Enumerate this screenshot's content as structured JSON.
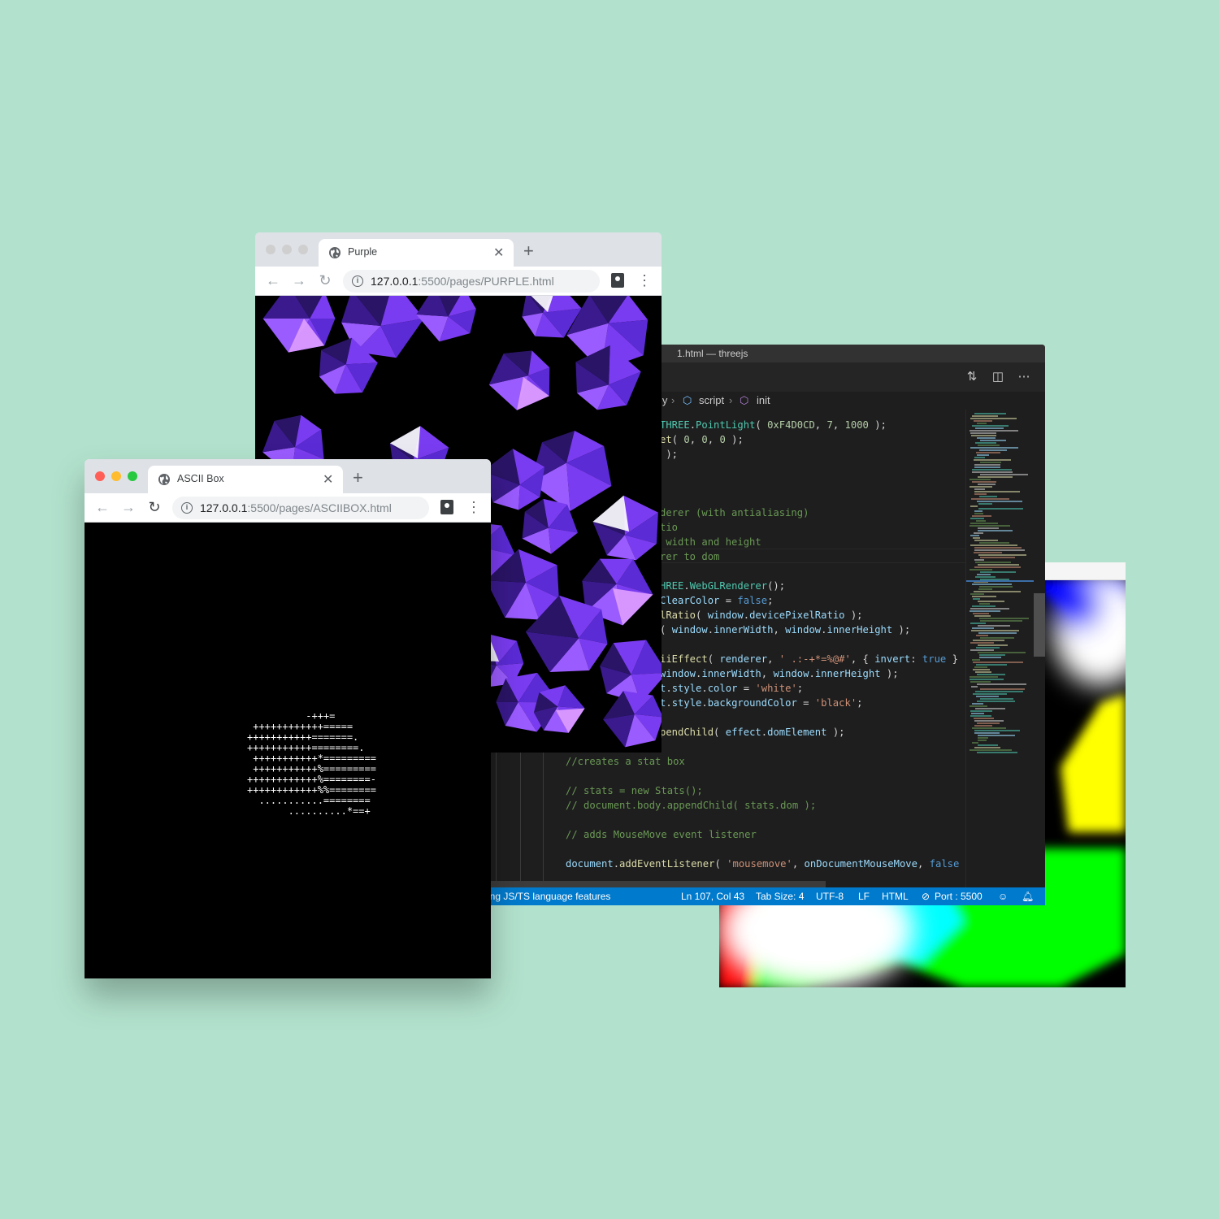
{
  "colorful_window": {
    "colors": [
      "#0000ff",
      "#ffffff",
      "#ffff00",
      "#000000",
      "#00ff00",
      "#ff0000",
      "#00ffff"
    ]
  },
  "vscode": {
    "title": "1.html — threejs",
    "breadcrumbs": [
      "ly",
      "script",
      "init"
    ],
    "code_lines": [
      {
        "parts": [
          [
            "k",
            "THREE"
          ],
          [
            "",
            "."
          ],
          [
            "k",
            "PointLight"
          ],
          [
            "",
            "( "
          ],
          [
            "n",
            "0xF4D0CD"
          ],
          [
            "",
            ", "
          ],
          [
            "n",
            "7"
          ],
          [
            "",
            ", "
          ],
          [
            "n",
            "1000"
          ],
          [
            "",
            " );"
          ]
        ]
      },
      {
        "parts": [
          [
            "f",
            "et"
          ],
          [
            "",
            "( "
          ],
          [
            "n",
            "0"
          ],
          [
            "",
            ", "
          ],
          [
            "n",
            "0"
          ],
          [
            "",
            ", "
          ],
          [
            "n",
            "0"
          ],
          [
            "",
            " );"
          ]
        ]
      },
      {
        "parts": [
          [
            "",
            " );"
          ]
        ]
      },
      {
        "parts": []
      },
      {
        "parts": []
      },
      {
        "parts": [
          [
            "",
            "    "
          ]
        ]
      },
      {
        "parts": [
          [
            "c",
            "derer (with antialiasing)"
          ]
        ]
      },
      {
        "parts": [
          [
            "c",
            "tio"
          ]
        ]
      },
      {
        "parts": [
          [
            "c",
            " width and height"
          ]
        ]
      },
      {
        "parts": [
          [
            "c",
            "rer to dom"
          ]
        ]
      },
      {
        "parts": []
      },
      {
        "parts": [
          [
            "k",
            "HREE"
          ],
          [
            "",
            "."
          ],
          [
            "k",
            "WebGLRenderer"
          ],
          [
            "",
            "();"
          ]
        ]
      },
      {
        "parts": [
          [
            "v",
            "ClearColor"
          ],
          [
            "",
            " = "
          ],
          [
            "b",
            "false"
          ],
          [
            "",
            ";"
          ]
        ]
      },
      {
        "parts": [
          [
            "f",
            "lRatio"
          ],
          [
            "",
            "( "
          ],
          [
            "v",
            "window"
          ],
          [
            "",
            "."
          ],
          [
            "v",
            "devicePixelRatio"
          ],
          [
            "",
            " );"
          ]
        ]
      },
      {
        "parts": [
          [
            "",
            "( "
          ],
          [
            "v",
            "window"
          ],
          [
            "",
            "."
          ],
          [
            "v",
            "innerWidth"
          ],
          [
            "",
            ", "
          ],
          [
            "v",
            "window"
          ],
          [
            "",
            "."
          ],
          [
            "v",
            "innerHeight"
          ],
          [
            "",
            " );"
          ]
        ]
      },
      {
        "parts": []
      },
      {
        "parts": [
          [
            "f",
            "iiEffect"
          ],
          [
            "",
            "( "
          ],
          [
            "v",
            "renderer"
          ],
          [
            "",
            ", "
          ],
          [
            "s",
            "' .:-+*=%@#'"
          ],
          [
            "",
            ", { "
          ],
          [
            "v",
            "invert"
          ],
          [
            "",
            ": "
          ],
          [
            "b",
            "true"
          ],
          [
            "",
            " } )"
          ]
        ]
      },
      {
        "parts": [
          [
            "v",
            "window"
          ],
          [
            "",
            "."
          ],
          [
            "v",
            "innerWidth"
          ],
          [
            "",
            ", "
          ],
          [
            "v",
            "window"
          ],
          [
            "",
            "."
          ],
          [
            "v",
            "innerHeight"
          ],
          [
            "",
            " );"
          ]
        ]
      },
      {
        "parts": [
          [
            "v",
            "t"
          ],
          [
            "",
            "."
          ],
          [
            "v",
            "style"
          ],
          [
            "",
            "."
          ],
          [
            "v",
            "color"
          ],
          [
            "",
            " = "
          ],
          [
            "s",
            "'white'"
          ],
          [
            "",
            ";"
          ]
        ]
      },
      {
        "parts": [
          [
            "v",
            "t"
          ],
          [
            "",
            "."
          ],
          [
            "v",
            "style"
          ],
          [
            "",
            "."
          ],
          [
            "v",
            "backgroundColor"
          ],
          [
            "",
            " = "
          ],
          [
            "s",
            "'black'"
          ],
          [
            "",
            ";"
          ]
        ]
      },
      {
        "parts": []
      },
      {
        "parts": [
          [
            "f",
            "pendChild"
          ],
          [
            "",
            "( "
          ],
          [
            "v",
            "effect"
          ],
          [
            "",
            "."
          ],
          [
            "v",
            "domElement"
          ],
          [
            "",
            " );"
          ]
        ]
      },
      {
        "parts": []
      },
      {
        "parts": [
          [
            "c",
            "//creates a stat box"
          ]
        ]
      },
      {
        "parts": []
      },
      {
        "parts": [
          [
            "c",
            "// stats = new Stats();"
          ]
        ]
      },
      {
        "parts": [
          [
            "c",
            "// document.body.appendChild( stats.dom );"
          ]
        ]
      },
      {
        "parts": []
      },
      {
        "parts": [
          [
            "c",
            "// adds MouseMove event listener"
          ]
        ]
      },
      {
        "parts": []
      },
      {
        "parts": [
          [
            "v",
            "document"
          ],
          [
            "",
            "."
          ],
          [
            "f",
            "addEventListener"
          ],
          [
            "",
            "( "
          ],
          [
            "s",
            "'mousemove'"
          ],
          [
            "",
            ", "
          ],
          [
            "v",
            "onDocumentMouseMove"
          ],
          [
            "",
            ", "
          ],
          [
            "b",
            "false"
          ],
          [
            "",
            " )"
          ]
        ]
      }
    ],
    "status": {
      "left": "ing JS/TS language features",
      "position": "Ln 107, Col 43",
      "tab_size": "Tab Size: 4",
      "encoding": "UTF-8",
      "eol": "LF",
      "language": "HTML",
      "port": "Port : 5500"
    }
  },
  "purple_browser": {
    "tab_title": "Purple",
    "url_prefix": "127.0.0.1",
    "url_rest": ":5500/pages/PURPLE.html",
    "shape_colors": [
      "#5b2bd6",
      "#7a3cf0",
      "#9b5cff",
      "#3a1a8c",
      "#e0a0ff",
      "#ffffff",
      "#2a1466"
    ]
  },
  "ascii_browser": {
    "tab_title": "ASCII Box",
    "url_prefix": "127.0.0.1",
    "url_rest": ":5500/pages/ASCIIBOX.html",
    "ascii_lines": [
      "          -+++=",
      " ++++++++++++=====",
      "+++++++++++=======.",
      "+++++++++++========.",
      " +++++++++++*=========",
      " +++++++++++%=========",
      "++++++++++++%========-",
      "++++++++++++%%========",
      "  ...........========",
      "       ..........*==+"
    ]
  }
}
